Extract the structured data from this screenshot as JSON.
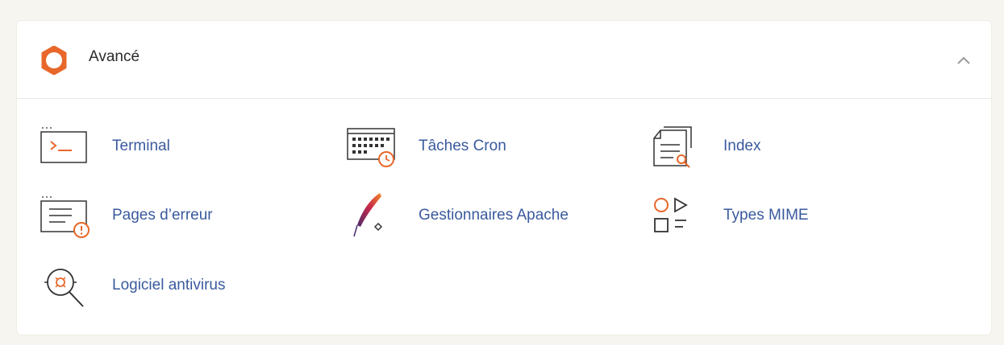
{
  "section": {
    "title": "Avancé",
    "expanded": true,
    "accent_color": "#e8672a",
    "link_color": "#3a5a9e",
    "items": [
      {
        "label": "Terminal",
        "icon": "terminal-icon"
      },
      {
        "label": "Tâches Cron",
        "icon": "cron-calendar-icon"
      },
      {
        "label": "Index",
        "icon": "index-document-icon"
      },
      {
        "label": "Pages d’erreur",
        "icon": "error-page-icon"
      },
      {
        "label": "Gestionnaires Apache",
        "icon": "apache-feather-icon"
      },
      {
        "label": "Types MIME",
        "icon": "mime-types-icon"
      },
      {
        "label": "Logiciel antivirus",
        "icon": "antivirus-icon"
      }
    ]
  }
}
